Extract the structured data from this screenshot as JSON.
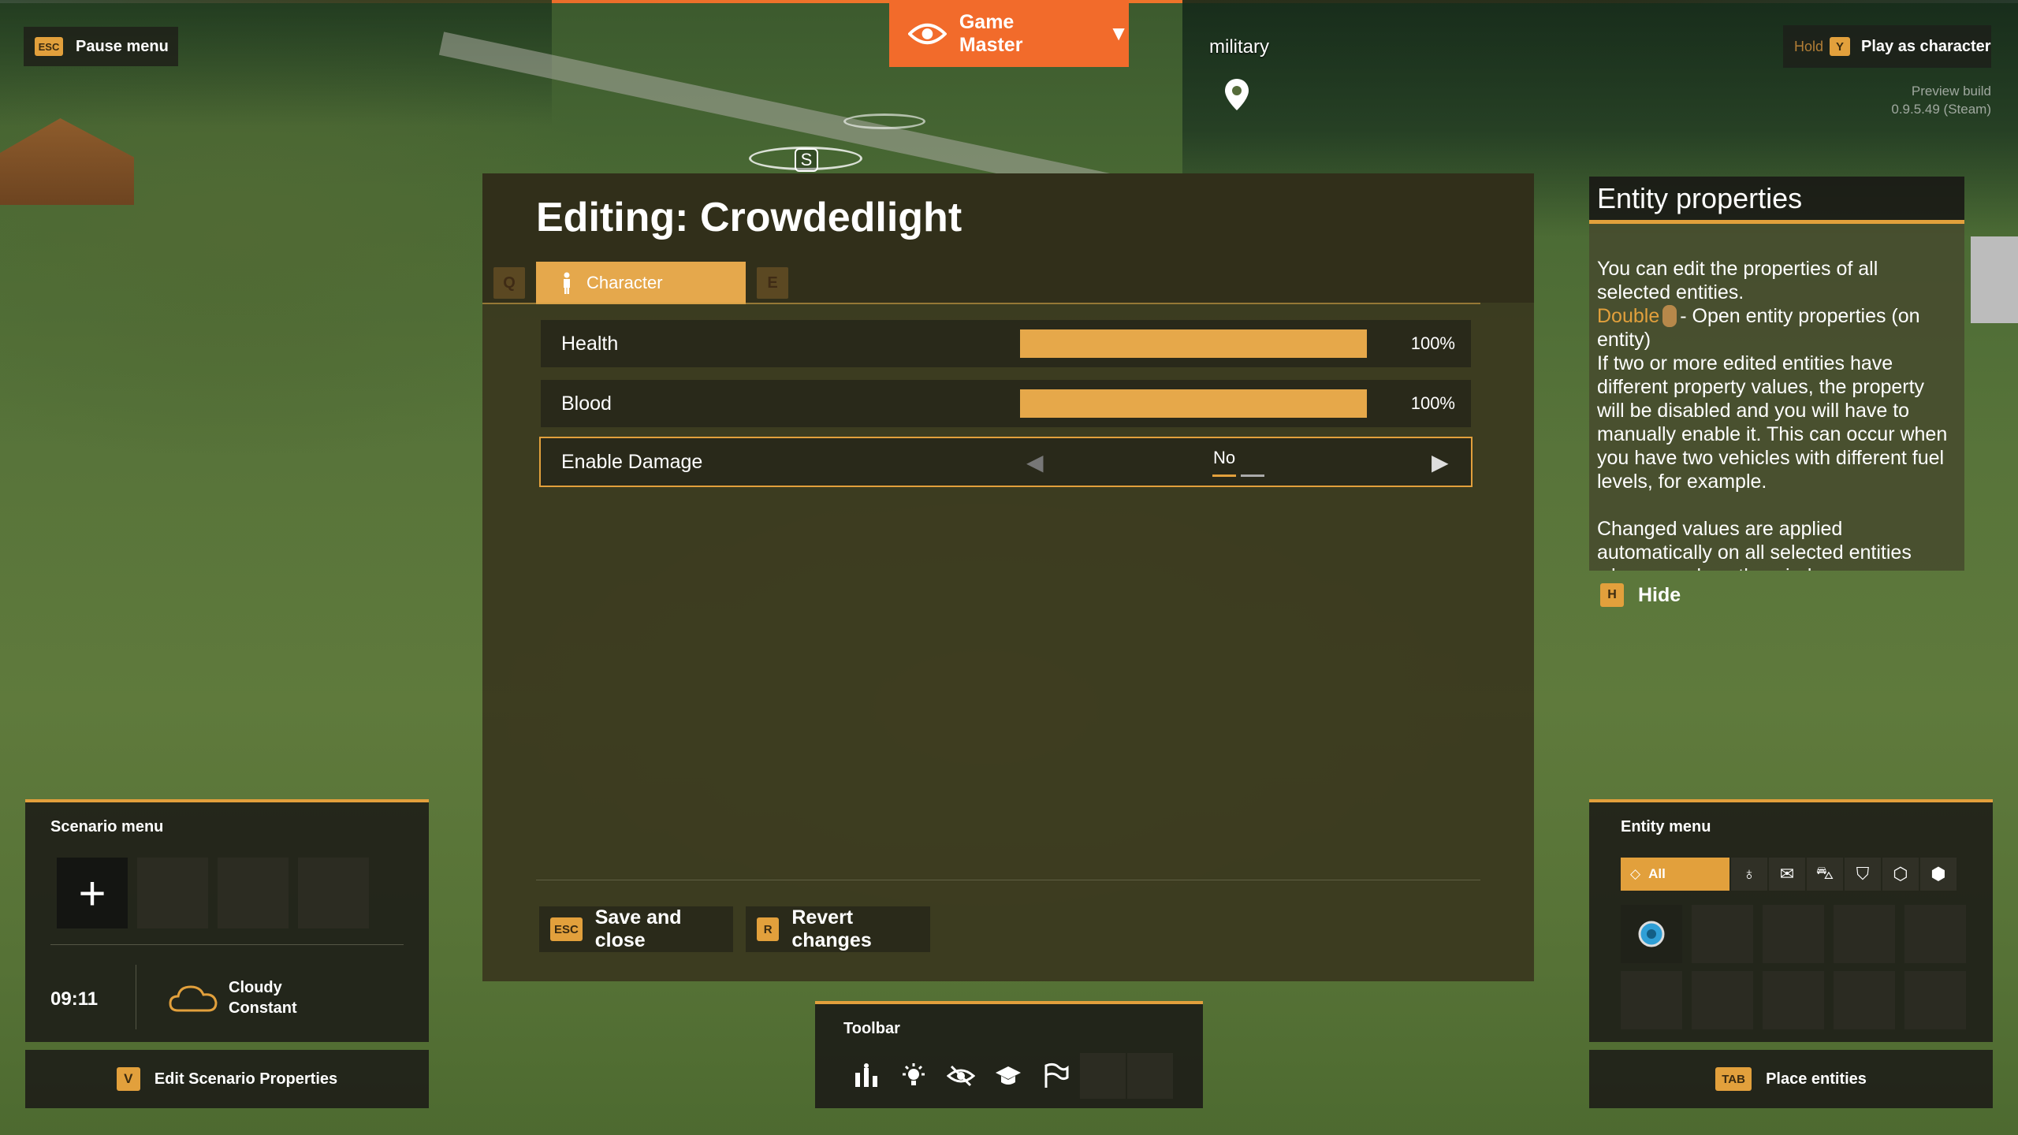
{
  "top_left": {
    "key": "ESC",
    "label": "Pause menu"
  },
  "game_master": {
    "label": "Game Master"
  },
  "map": {
    "marker_label": "military",
    "s_marker": "S"
  },
  "top_right": {
    "hold": "Hold",
    "key": "Y",
    "label": "Play as character",
    "build_line1": "Preview build",
    "build_line2": "0.9.5.49 (Steam)"
  },
  "editor": {
    "title": "Editing: Crowdedlight",
    "tab_prev_key": "Q",
    "tab_next_key": "E",
    "active_tab": "Character",
    "properties": [
      {
        "label": "Health",
        "value": "100%",
        "level": 1.0
      },
      {
        "label": "Blood",
        "value": "100%",
        "level": 1.0
      }
    ],
    "selector": {
      "label": "Enable Damage",
      "value": "No",
      "option_count": 2,
      "selected_index": 0
    },
    "save": {
      "key": "ESC",
      "label": "Save and close"
    },
    "revert": {
      "key": "R",
      "label": "Revert changes"
    }
  },
  "entity_properties": {
    "title": "Entity properties",
    "p1": "You can edit the properties of all selected entities.",
    "double": "Double",
    "double_rest": "- Open entity properties (on entity)",
    "p3": "If two or more edited entities have different property values, the property will be disabled and you will have to manually enable it. This can occur when you have two vehicles with different fuel levels, for example.",
    "p4": "Changed values are applied automatically on all selected entities when you close the window.",
    "hide_key": "H",
    "hide_label": "Hide"
  },
  "scenario_menu": {
    "title": "Scenario menu",
    "time": "09:11",
    "weather_line1": "Cloudy",
    "weather_line2": "Constant",
    "footer_key": "V",
    "footer_label": "Edit Scenario Properties"
  },
  "toolbar": {
    "title": "Toolbar"
  },
  "entity_menu": {
    "title": "Entity menu",
    "all_label": "All",
    "footer_key": "TAB",
    "footer_label": "Place entities"
  },
  "colors": {
    "accent": "#e2a03c",
    "game_master_orange": "#f26b2b",
    "panel_bg": "#3a381e"
  }
}
